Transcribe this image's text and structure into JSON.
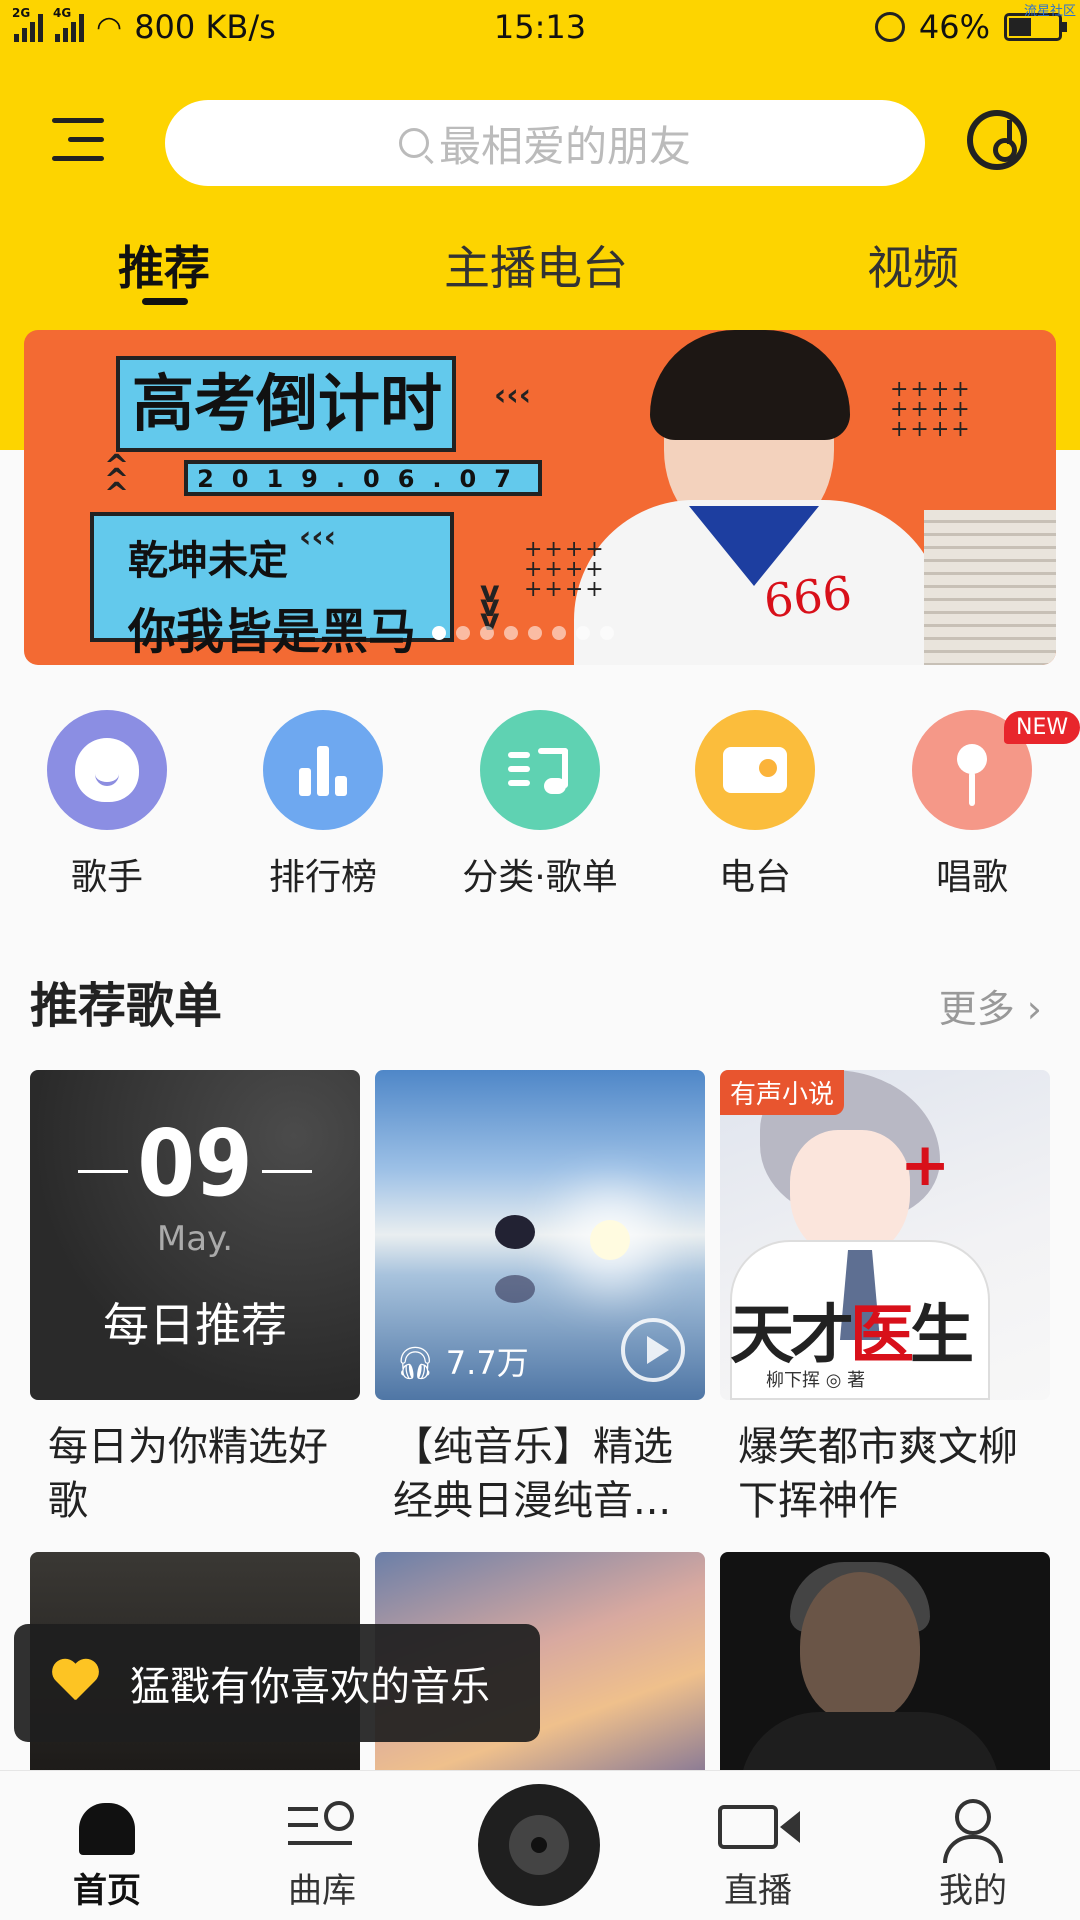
{
  "status_bar": {
    "network_1": "2G",
    "network_2": "4G",
    "speed": "800 KB/s",
    "time": "15:13",
    "battery": "46%",
    "battery_level": 0.46,
    "corner_tag": "流星社区"
  },
  "header": {
    "search_placeholder": "最相爱的朋友"
  },
  "tabs": [
    {
      "label": "推荐",
      "active": true
    },
    {
      "label": "主播电台",
      "active": false
    },
    {
      "label": "视频",
      "active": false
    }
  ],
  "banner": {
    "headline": "高考倒计时",
    "date": "2019.06.07",
    "line1": "乾坤未定",
    "line2": "你我皆是黑马",
    "number": "666",
    "slide_count": 8,
    "active_slide": 0
  },
  "categories": [
    {
      "label": "歌手",
      "icon": "singer-icon",
      "color": "#8b8ee3"
    },
    {
      "label": "排行榜",
      "icon": "chart-icon",
      "color": "#6ea8f0"
    },
    {
      "label": "分类·歌单",
      "icon": "playlist-icon",
      "color": "#5fd2b2"
    },
    {
      "label": "电台",
      "icon": "radio-icon",
      "color": "#fbbd3c"
    },
    {
      "label": "唱歌",
      "icon": "microphone-icon",
      "color": "#f59888"
    }
  ],
  "new_badge": "NEW",
  "section": {
    "title": "推荐歌单",
    "more": "更多 ›"
  },
  "playlists": [
    {
      "title": "每日为你精选好歌",
      "day": "09",
      "month": "May.",
      "cover_text": "每日推荐"
    },
    {
      "title": "【纯音乐】精选经典日漫纯音...",
      "play_count": "7.7万"
    },
    {
      "title": "爆笑都市爽文柳下挥神作",
      "tag": "有声小说",
      "cover_big_1": "天才",
      "cover_big_2": "医",
      "cover_big_3": "生",
      "cover_author": "柳下挥 ◎ 著"
    },
    {
      "title": ""
    },
    {
      "title": ""
    },
    {
      "title": ""
    }
  ],
  "toast": {
    "text": "猛戳有你喜欢的音乐"
  },
  "bottom_nav": [
    {
      "label": "首页",
      "icon": "home-icon",
      "active": true
    },
    {
      "label": "曲库",
      "icon": "library-icon",
      "active": false
    },
    {
      "label": "直播",
      "icon": "live-video-icon",
      "active": false
    },
    {
      "label": "我的",
      "icon": "profile-icon",
      "active": false
    }
  ]
}
